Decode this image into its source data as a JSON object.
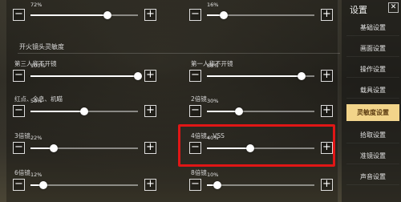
{
  "section_title": "开火镜头灵敏度",
  "rows": [
    {
      "label": "8倍镜",
      "value_text": "72%",
      "value": 0.72
    },
    {
      "label": "8倍镜",
      "value_text": "16%",
      "value": 0.16
    },
    {
      "label": "第三人称不开镜",
      "value_text": "100%",
      "value": 1.0
    },
    {
      "label": "第一人称不开镜",
      "value_text": "88%",
      "value": 0.88
    },
    {
      "label": "红点、全息、机瞄",
      "value_text": "50%",
      "value": 0.5
    },
    {
      "label": "2倍镜",
      "value_text": "30%",
      "value": 0.3
    },
    {
      "label": "3倍镜",
      "value_text": "22%",
      "value": 0.22
    },
    {
      "label": "4倍镜、VSS",
      "value_text": "40%",
      "value": 0.4
    },
    {
      "label": "6倍镜",
      "value_text": "12%",
      "value": 0.12
    },
    {
      "label": "8倍镜",
      "value_text": "10%",
      "value": 0.1
    }
  ],
  "buttons": {
    "minus": "−",
    "plus": "+"
  },
  "highlight_color": "#e01616",
  "sidebar": {
    "title": "设置",
    "close": "✕",
    "items": [
      {
        "label": "基础设置",
        "active": false
      },
      {
        "label": "画面设置",
        "active": false
      },
      {
        "label": "操作设置",
        "active": false
      },
      {
        "label": "载具设置",
        "active": false
      },
      {
        "label": "灵敏度设置",
        "active": true
      },
      {
        "label": "拾取设置",
        "active": false
      },
      {
        "label": "准镜设置",
        "active": false
      },
      {
        "label": "声音设置",
        "active": false
      }
    ]
  }
}
